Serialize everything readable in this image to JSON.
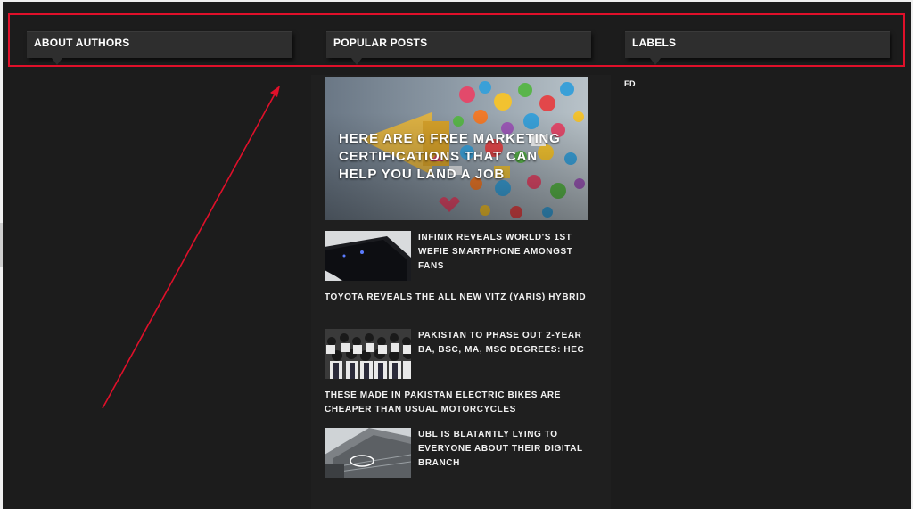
{
  "widgets": {
    "about": {
      "title": "ABOUT AUTHORS"
    },
    "popular": {
      "title": "POPULAR POSTS"
    },
    "labels": {
      "title": "LABELS"
    }
  },
  "featured_post": {
    "title": "HERE ARE 6 FREE MARKETING CERTIFICATIONS THAT CAN HELP YOU LAND A JOB"
  },
  "posts": [
    {
      "title": "INFINIX REVEALS WORLD'S 1ST WEFIE SMARTPHONE AMONGST FANS",
      "has_thumb": true
    },
    {
      "title": "TOYOTA REVEALS THE ALL NEW VITZ (YARIS) HYBRID",
      "has_thumb": false
    },
    {
      "title": "PAKISTAN TO PHASE OUT 2-YEAR BA, BSC, MA, MSC DEGREES: HEC",
      "has_thumb": true
    },
    {
      "title": "THESE MADE IN PAKISTAN ELECTRIC BIKES ARE CHEAPER THAN USUAL MOTORCYCLES",
      "has_thumb": false
    },
    {
      "title": "UBL IS BLATANTLY LYING TO EVERYONE ABOUT THEIR DIGITAL BRANCH",
      "has_thumb": true
    }
  ],
  "label_items": [
    "ED"
  ],
  "colors": {
    "background": "#1c1c1c",
    "header": "#2e2e2e",
    "highlight": "#e0102a",
    "text": "#ffffff"
  }
}
